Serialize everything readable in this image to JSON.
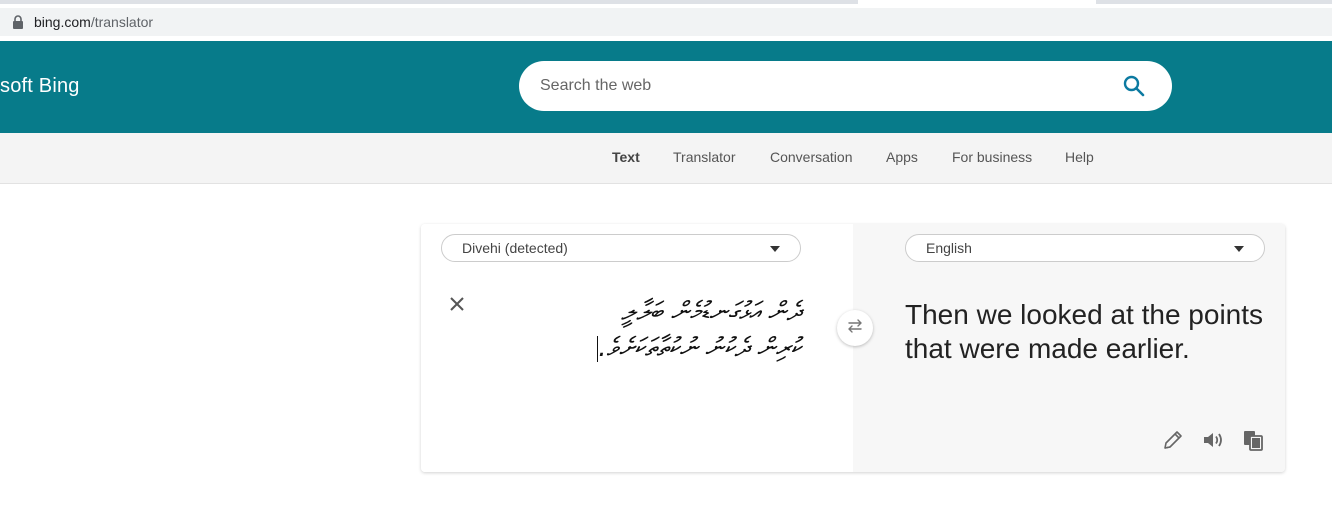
{
  "browser": {
    "url_domain": "bing.com",
    "url_path": "/translator"
  },
  "header": {
    "brand": "soft Bing",
    "search_placeholder": "Search the web"
  },
  "nav": {
    "items": [
      {
        "label": "Text",
        "active": true
      },
      {
        "label": "Translator",
        "active": false
      },
      {
        "label": "Conversation",
        "active": false
      },
      {
        "label": "Apps",
        "active": false
      },
      {
        "label": "For business",
        "active": false
      },
      {
        "label": "Help",
        "active": false
      }
    ]
  },
  "translator": {
    "source_language": "Divehi (detected)",
    "target_language": "English",
    "source_text_line1": "ދެން އަޅުގަނޑުމެން ބަލާލީ",
    "source_text_line2": "ކުރިން ދެކުނު ނުކުތާތަކަށެވެ.",
    "translation": "Then we looked at the points that were made earlier."
  },
  "colors": {
    "header_bg": "#077b8a",
    "nav_bg": "#f4f4f4",
    "accent": "#0c7aa1"
  },
  "icons": {
    "lock": "lock-icon",
    "search": "search-icon",
    "clear": "close-icon",
    "swap": "swap-arrows-icon",
    "edit": "pencil-icon",
    "speaker": "speaker-icon",
    "copy": "copy-icon"
  }
}
